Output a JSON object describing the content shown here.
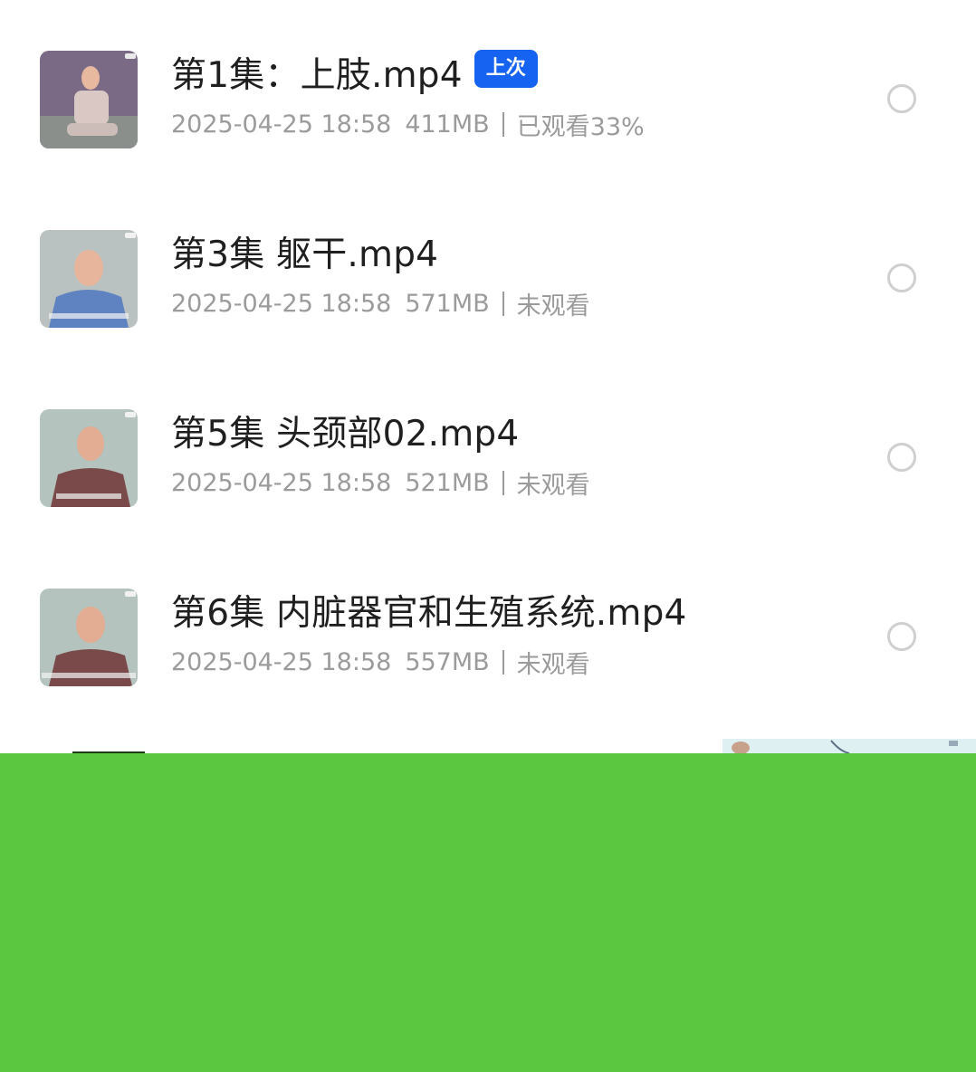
{
  "files": [
    {
      "title": "第1集：上肢.mp4",
      "badge": "上次",
      "date": "2025-04-25 18:58",
      "size": "411MB",
      "status": "已观看33%",
      "thumbnail": {
        "bg": "#7b6a86",
        "shirt": "#d9c8c4",
        "floor": "#8a8f8c"
      }
    },
    {
      "title": "第3集 躯干.mp4",
      "date": "2025-04-25 18:58",
      "size": "571MB",
      "status": "未观看",
      "thumbnail": {
        "bg": "#b9c2c0",
        "shirt": "#5f82c0",
        "floor": "#5f82c0"
      }
    },
    {
      "title": "第5集 头颈部02.mp4",
      "date": "2025-04-25 18:58",
      "size": "521MB",
      "status": "未观看",
      "thumbnail": {
        "bg": "#b4c3bd",
        "shirt": "#7a4a4a",
        "floor": "#7a4a4a"
      }
    },
    {
      "title": "第6集 内脏器官和生殖系统.mp4",
      "date": "2025-04-25 18:58",
      "size": "557MB",
      "status": "未观看",
      "thumbnail": {
        "bg": "#b4c3bd",
        "shirt": "#7a4a4a",
        "floor": "#7a4a4a"
      }
    }
  ],
  "colors": {
    "title": "#1f1f1f",
    "meta": "#9b9b9b",
    "badge_bg": "#1663f2",
    "radio_border": "#cfcfcf",
    "overlay_green": "#5bc740"
  },
  "icons": {
    "select": "radio-unchecked-icon"
  }
}
